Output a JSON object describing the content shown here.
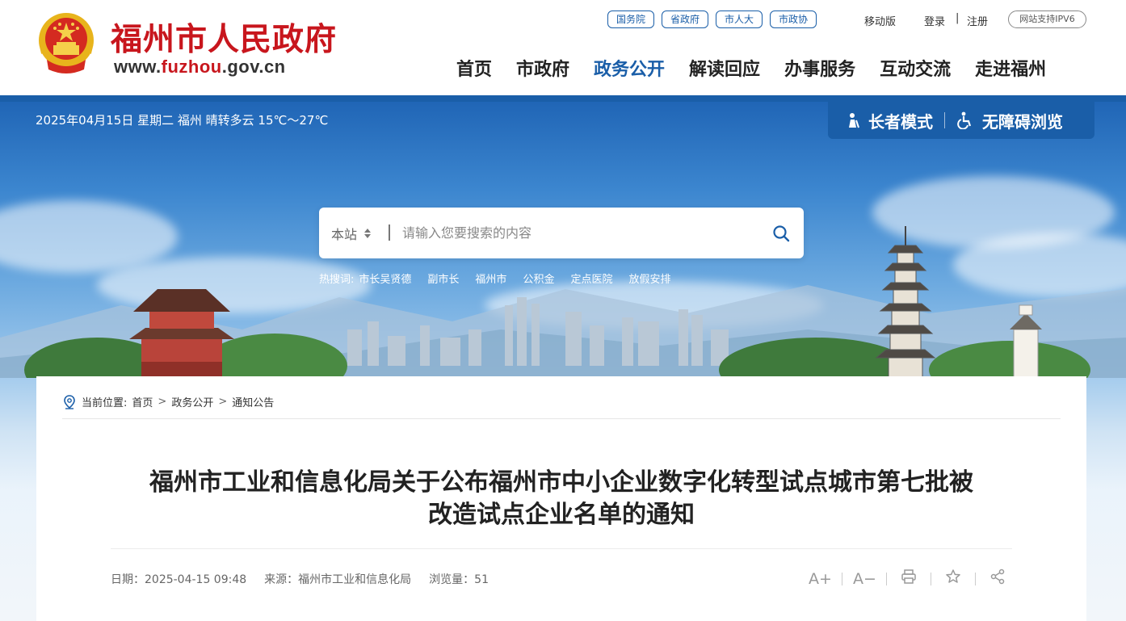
{
  "header": {
    "site_name": "福州市人民政府",
    "url_prefix": "www.",
    "url_brand": "fuzhou",
    "url_suffix": ".gov.cn",
    "top_links": [
      "国务院",
      "省政府",
      "市人大",
      "市政协"
    ],
    "mobile": "移动版",
    "login": "登录",
    "separator": "|",
    "register": "注册",
    "ipv6": "网站支持IPV6",
    "nav": [
      "首页",
      "市政府",
      "政务公开",
      "解读回应",
      "办事服务",
      "互动交流",
      "走进福州"
    ],
    "active_nav": "政务公开"
  },
  "banner": {
    "date_weather": "2025年04月15日 星期二  福州 晴转多云 15℃～27℃",
    "elder_mode": "长者模式",
    "accessible": "无障碍浏览",
    "search": {
      "scope": "本站",
      "placeholder": "请输入您要搜索的内容"
    },
    "hot_label": "热搜词:",
    "hot_words": [
      "市长吴贤德",
      "副市长",
      "福州市",
      "公积金",
      "定点医院",
      "放假安排"
    ]
  },
  "breadcrumb": {
    "label": "当前位置:",
    "items": [
      "首页",
      "政务公开",
      "通知公告"
    ]
  },
  "article": {
    "title_line1": "福州市工业和信息化局关于公布福州市中小企业数字化转型试点城市第七批被",
    "title_line2": "改造试点企业名单的通知",
    "date": "日期：2025-04-15 09:48",
    "source": "来源：福州市工业和信息化局",
    "views": "浏览量：51",
    "tools": [
      "A+",
      "A−"
    ]
  },
  "colors": {
    "brand_red": "#c8161d",
    "brand_blue": "#1a5ea8"
  }
}
